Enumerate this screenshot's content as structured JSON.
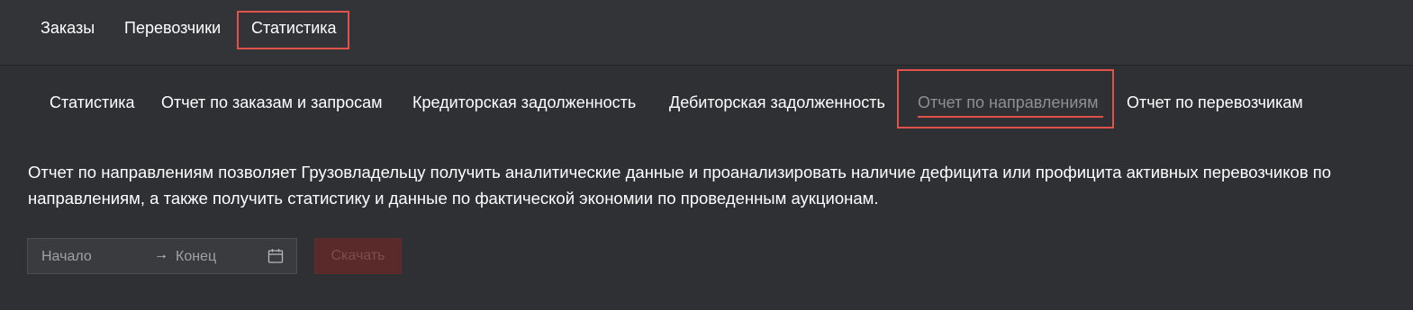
{
  "topnav": {
    "items": [
      {
        "label": "Заказы"
      },
      {
        "label": "Перевозчики"
      },
      {
        "label": "Статистика",
        "active": true
      }
    ]
  },
  "subnav": {
    "items": [
      {
        "label": "Статистика"
      },
      {
        "label": "Отчет по заказам и запросам"
      },
      {
        "label": "Кредиторская задолженность"
      },
      {
        "label": "Дебиторская задолженность"
      },
      {
        "label": "Отчет по направлениям",
        "active": true
      },
      {
        "label": "Отчет по перевозчикам"
      }
    ]
  },
  "description": "Отчет по направлениям позволяет Грузовладельцу получить аналитические данные и проанализировать наличие дефицита или профицита активных перевозчиков по направлениям, а также получить статистику и данные по фактической экономии по проведенным аукционам.",
  "date_range": {
    "start_placeholder": "Начало",
    "end_placeholder": "Конец",
    "separator": "→",
    "icon": "calendar-icon"
  },
  "download_button": {
    "label": "Скачать",
    "disabled": true
  },
  "colors": {
    "background": "#2f3034",
    "accent": "#e2524b",
    "text": "#ffffff",
    "muted_text": "#8e8f94"
  }
}
